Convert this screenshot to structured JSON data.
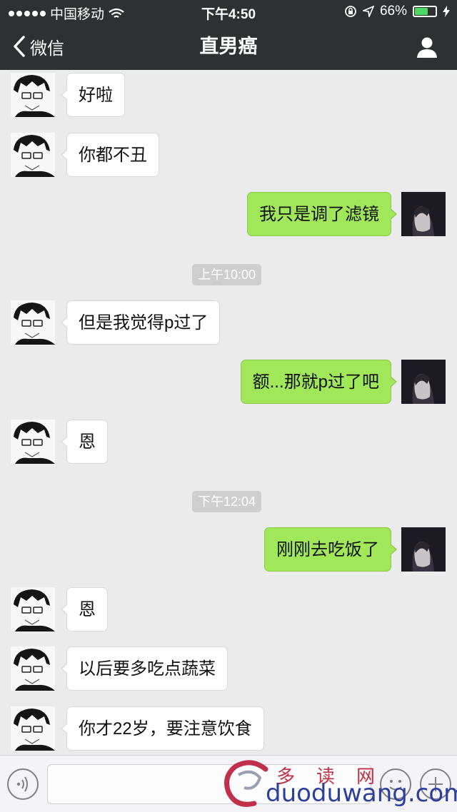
{
  "status_bar": {
    "carrier": "中国移动",
    "time": "下午4:50",
    "battery_text": "66%",
    "battery_level": 0.66
  },
  "nav": {
    "back_label": "微信",
    "title": "直男癌"
  },
  "messages": [
    {
      "type": "in",
      "text": "好啦"
    },
    {
      "type": "in",
      "text": "你都不丑"
    },
    {
      "type": "out",
      "text": "我只是调了滤镜"
    },
    {
      "type": "time",
      "text": "上午10:00"
    },
    {
      "type": "in",
      "text": "但是我觉得p过了"
    },
    {
      "type": "out",
      "text": "额...那就p过了吧"
    },
    {
      "type": "in",
      "text": "恩"
    },
    {
      "type": "time",
      "text": "下午12:04"
    },
    {
      "type": "out",
      "text": "刚刚去吃饭了"
    },
    {
      "type": "in",
      "text": "恩"
    },
    {
      "type": "in",
      "text": "以后要多吃点蔬菜"
    },
    {
      "type": "in",
      "text": "你才22岁，要注意饮食"
    }
  ],
  "watermark": {
    "cn": "多读网",
    "en": "duoduwang.com"
  },
  "colors": {
    "nav_bg": "#2e3132",
    "chat_bg": "#ebebeb",
    "out_bubble": "#a0e75a",
    "in_bubble": "#ffffff"
  }
}
